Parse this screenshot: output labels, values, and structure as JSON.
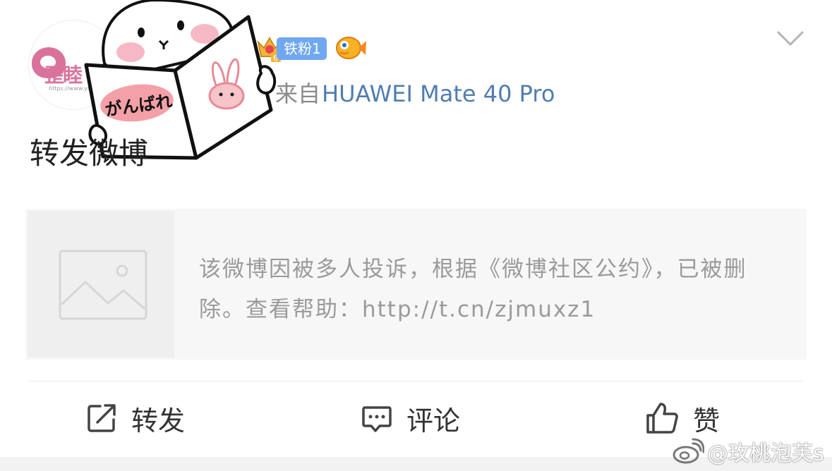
{
  "post": {
    "user": {
      "avatar_text": "歪睦",
      "avatar_url_text": "https://www.ymsy",
      "avatar_label": "avatar"
    },
    "badges": {
      "fan_level": "6",
      "fan_label": "铁粉1"
    },
    "source_prefix": "来自",
    "source_device": "HUAWEI Mate 40 Pro",
    "text": "转发微博",
    "sticker_text": "がんばれ"
  },
  "repost": {
    "notice": "该微博因被多人投诉，根据《微博社区公约》，已被删除。查看帮助：http://t.cn/zjmuxz1"
  },
  "actions": {
    "repost_label": "转发",
    "comment_label": "评论",
    "like_label": "赞"
  },
  "watermark": {
    "text": "@玫桃泡芙s"
  },
  "icons": {
    "avatar": "paw-logo-icon",
    "crown": "crown-badge-icon",
    "fish": "fish-badge-icon",
    "chevron": "chevron-down-icon",
    "image_placeholder": "image-placeholder-icon",
    "repost": "repost-icon",
    "comment": "comment-icon",
    "like": "thumbs-up-icon",
    "weibo": "weibo-logo-icon"
  },
  "colors": {
    "link": "#507daf",
    "fan_badge": "#6fa8f0",
    "notice_text": "#9a9a9a",
    "card_background": "#f7f7f7"
  }
}
